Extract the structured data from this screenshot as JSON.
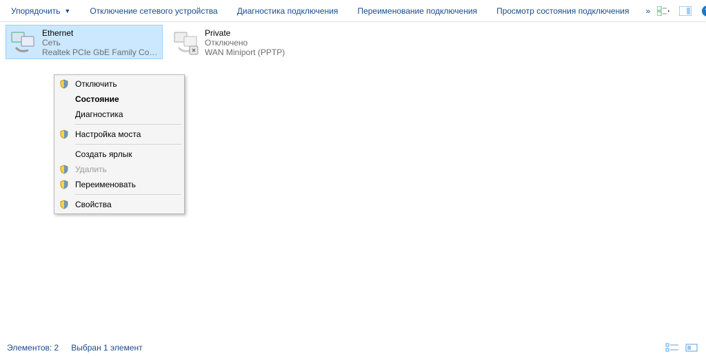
{
  "toolbar": {
    "organize": "Упорядочить",
    "btn1": "Отключение сетевого устройства",
    "btn2": "Диагностика подключения",
    "btn3": "Переименование подключения",
    "btn4": "Просмотр состояния подключения"
  },
  "adapters": [
    {
      "name": "Ethernet",
      "line2": "Сеть",
      "line3": "Realtek PCIe GbE Family Controller"
    },
    {
      "name": "Private",
      "line2": "Отключено",
      "line3": "WAN Miniport (PPTP)"
    }
  ],
  "context": {
    "disconnect": "Отключить",
    "status": "Состояние",
    "diag": "Диагностика",
    "bridge": "Настройка моста",
    "shortcut": "Создать ярлык",
    "delete": "Удалить",
    "rename": "Переименовать",
    "props": "Свойства"
  },
  "status": {
    "count": "Элементов: 2",
    "selected": "Выбран 1 элемент"
  }
}
